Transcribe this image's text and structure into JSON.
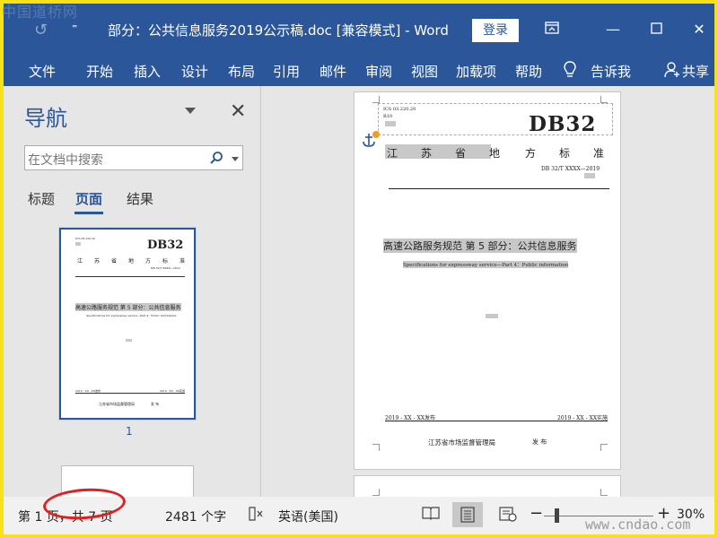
{
  "watermark_top": "中国道桥网",
  "watermark_bottom": "www.cndao.com",
  "titlebar": {
    "title": "部分：公共信息服务2019公示稿.doc [兼容模式] - Word",
    "signin": "登录"
  },
  "ribbon": {
    "tabs": [
      "文件",
      "开始",
      "插入",
      "设计",
      "布局",
      "引用",
      "邮件",
      "审阅",
      "视图",
      "加载项",
      "帮助"
    ],
    "tell_me": "告诉我",
    "share": "共享"
  },
  "nav": {
    "title": "导航",
    "search_placeholder": "在文档中搜索",
    "tabs": [
      "标题",
      "页面",
      "结果"
    ],
    "active_tab": "页面",
    "thumb_page_number": "1"
  },
  "document": {
    "ics": "ICS 03.220.20",
    "code_line": "R10",
    "standard_code": "DB32",
    "province_chars": [
      "江",
      "苏",
      "省",
      "地",
      "方",
      "标",
      "准"
    ],
    "standard_number": "DB 32/T XXXX—2019",
    "title_cn": "高速公路服务规范  第 5 部分：公共信息服务",
    "title_en": "Specifications for expressway service—Part 4：Public information",
    "issue_date": "2019 - XX - XX发布",
    "implement_date": "2019 - XX - XX实施",
    "issuer": "江苏省市场监督管理局",
    "issue_word": "发  布"
  },
  "status": {
    "page_info": "第 1 页，共 7 页",
    "word_count": "2481 个字",
    "language": "英语(美国)",
    "zoom": "30%"
  },
  "colors": {
    "word_blue": "#2b579a",
    "frame_yellow": "#f7e21a",
    "annotation_red": "#e02020"
  }
}
